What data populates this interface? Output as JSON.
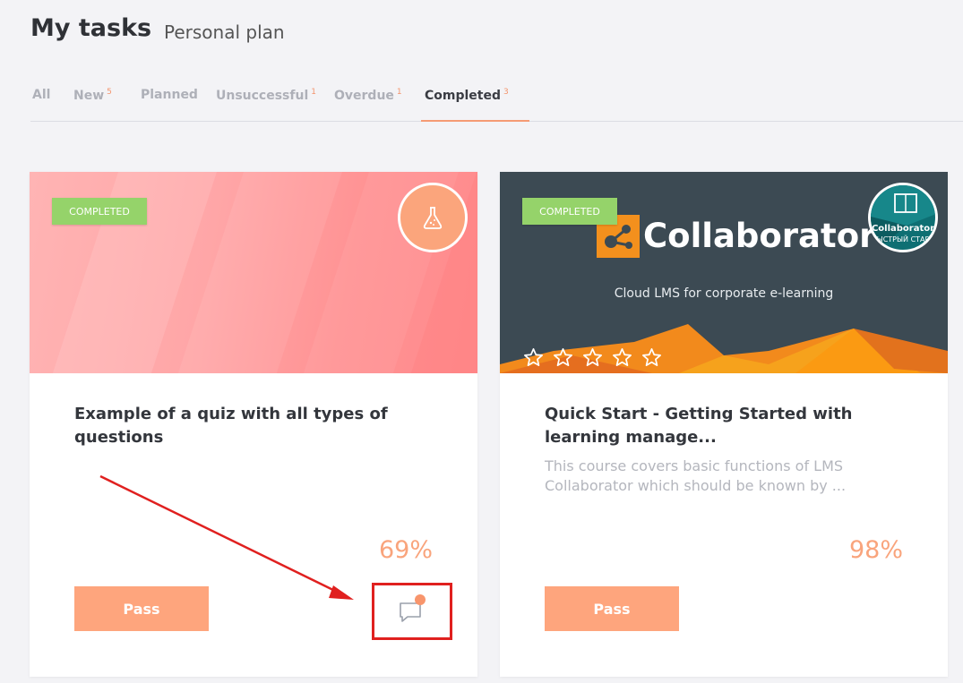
{
  "header": {
    "title": "My tasks",
    "subtitle": "Personal plan"
  },
  "tabs": [
    {
      "label": "All",
      "count": ""
    },
    {
      "label": "New",
      "count": "5"
    },
    {
      "label": "Planned",
      "count": ""
    },
    {
      "label": "Unsuccessful",
      "count": "1"
    },
    {
      "label": "Overdue",
      "count": "1"
    },
    {
      "label": "Completed",
      "count": "3",
      "active": true
    }
  ],
  "cards": [
    {
      "status_badge": "COMPLETED",
      "icon": "flask-icon",
      "title": "Example of a quiz with all types of questions",
      "description": "",
      "progress": "69%",
      "button_label": "Pass",
      "has_comment_notification": true
    },
    {
      "status_badge": "COMPLETED",
      "cover_title": "Collaborator",
      "cover_tagline": "Cloud LMS for corporate e-learning",
      "logo_text": "Collaborator",
      "logo_subtext": "ЫСТРЫЙ СТАР",
      "rating": {
        "stars_filled": 0,
        "stars_total": 5
      },
      "title": "Quick Start - Getting Started with learning manage...",
      "description": "This course covers basic functions of LMS Collaborator which should be known by ...",
      "progress": "98%",
      "button_label": "Pass"
    }
  ],
  "colors": {
    "accent": "#fea57d",
    "badge": "#95d36a",
    "annotation": "#e0201f"
  }
}
